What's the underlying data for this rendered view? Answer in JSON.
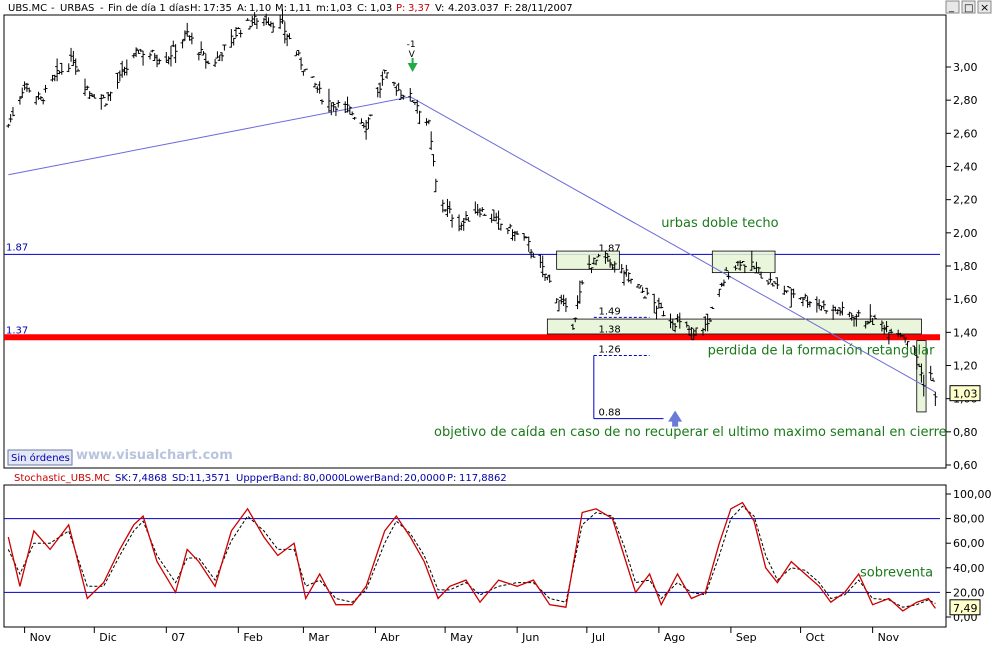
{
  "header": {
    "symbol": "UBS.MC",
    "name": "URBAS",
    "period": "Fin de día 1 días",
    "h_label": "H:",
    "h_value": "17:35",
    "a_label": "A:",
    "a_value": "1,10",
    "m_label": "M:",
    "m_value": "1,11",
    "lo_label": "m:",
    "lo_value": "1,03",
    "c_label": "C:",
    "c_value": "1,03",
    "p_label": "P:",
    "p_value": "3,37",
    "v_label": "V:",
    "v_value": "4.203.037",
    "f_label": "F:",
    "f_value": "28/11/2007"
  },
  "window_controls": {
    "minimize": "_",
    "maximize": "□",
    "close": "×"
  },
  "orders_button": "Sin órdenes",
  "watermark": "www.visualchart.com",
  "colors": {
    "price": "#000000",
    "trendline": "#6a6adc",
    "support": "#ff0000",
    "level": "#0000cc",
    "annotation": "#1a7a1a",
    "box_fill": "#e6f4d6",
    "stoch_k": "#cc0000",
    "stoch_d": "#000000",
    "band": "#0000cc"
  },
  "chart_data": [
    {
      "type": "ohlc",
      "symbol": "UBS.MC",
      "y_ticks": [
        "3,00",
        "2,80",
        "2,60",
        "2,40",
        "2,20",
        "2,00",
        "1,80",
        "1,60",
        "1,40",
        "1,20",
        "1,00",
        "0,80",
        "0,60"
      ],
      "ylim": [
        0.6,
        3.2
      ],
      "months": [
        "Nov",
        "Dic",
        "07",
        "Feb",
        "Mar",
        "Abr",
        "May",
        "Jun",
        "Jul",
        "Ago",
        "Sep",
        "Oct",
        "Nov"
      ],
      "close_path": [
        {
          "d": "2006-10-25",
          "c": 2.65
        },
        {
          "d": "2006-11-01",
          "c": 2.9
        },
        {
          "d": "2006-11-08",
          "c": 2.8
        },
        {
          "d": "2006-11-15",
          "c": 2.95
        },
        {
          "d": "2006-11-22",
          "c": 3.05
        },
        {
          "d": "2006-11-29",
          "c": 2.85
        },
        {
          "d": "2006-12-06",
          "c": 2.8
        },
        {
          "d": "2006-12-13",
          "c": 2.95
        },
        {
          "d": "2006-12-20",
          "c": 3.1
        },
        {
          "d": "2007-01-01",
          "c": 3.05
        },
        {
          "d": "2007-01-10",
          "c": 3.2
        },
        {
          "d": "2007-01-20",
          "c": 3.0
        },
        {
          "d": "2007-02-01",
          "c": 3.22
        },
        {
          "d": "2007-02-10",
          "c": 3.3
        },
        {
          "d": "2007-02-20",
          "c": 3.25
        },
        {
          "d": "2007-03-01",
          "c": 3.0
        },
        {
          "d": "2007-03-10",
          "c": 2.8
        },
        {
          "d": "2007-03-20",
          "c": 2.75
        },
        {
          "d": "2007-03-28",
          "c": 2.65
        },
        {
          "d": "2007-04-05",
          "c": 2.95
        },
        {
          "d": "2007-04-12",
          "c": 2.85
        },
        {
          "d": "2007-04-18",
          "c": 2.8
        },
        {
          "d": "2007-04-24",
          "c": 2.65
        },
        {
          "d": "2007-04-27",
          "c": 2.3
        },
        {
          "d": "2007-05-01",
          "c": 2.15
        },
        {
          "d": "2007-05-08",
          "c": 2.05
        },
        {
          "d": "2007-05-15",
          "c": 2.15
        },
        {
          "d": "2007-05-25",
          "c": 2.05
        },
        {
          "d": "2007-06-05",
          "c": 1.95
        },
        {
          "d": "2007-06-15",
          "c": 1.7
        },
        {
          "d": "2007-06-25",
          "c": 1.45
        },
        {
          "d": "2007-07-01",
          "c": 1.8
        },
        {
          "d": "2007-07-08",
          "c": 1.85
        },
        {
          "d": "2007-07-18",
          "c": 1.75
        },
        {
          "d": "2007-07-28",
          "c": 1.6
        },
        {
          "d": "2007-08-06",
          "c": 1.48
        },
        {
          "d": "2007-08-16",
          "c": 1.4
        },
        {
          "d": "2007-08-22",
          "c": 1.45
        },
        {
          "d": "2007-08-30",
          "c": 1.75
        },
        {
          "d": "2007-09-05",
          "c": 1.83
        },
        {
          "d": "2007-09-12",
          "c": 1.78
        },
        {
          "d": "2007-09-20",
          "c": 1.68
        },
        {
          "d": "2007-10-01",
          "c": 1.62
        },
        {
          "d": "2007-10-12",
          "c": 1.55
        },
        {
          "d": "2007-10-25",
          "c": 1.5
        },
        {
          "d": "2007-11-05",
          "c": 1.45
        },
        {
          "d": "2007-11-15",
          "c": 1.38
        },
        {
          "d": "2007-11-20",
          "c": 1.25
        },
        {
          "d": "2007-11-23",
          "c": 1.1
        },
        {
          "d": "2007-11-26",
          "c": 1.15
        },
        {
          "d": "2007-11-28",
          "c": 1.03
        }
      ],
      "last_price": "1,03",
      "trendlines": [
        {
          "from": {
            "d": "2006-10-25",
            "v": 2.35
          },
          "to": {
            "d": "2007-04-16",
            "v": 2.82
          }
        },
        {
          "from": {
            "d": "2007-04-16",
            "v": 2.82
          },
          "to": {
            "d": "2007-11-28",
            "v": 1.04
          }
        }
      ],
      "horizontal_levels": [
        {
          "value": 1.87,
          "label": "1.87"
        },
        {
          "value": 1.37,
          "label": "1.37",
          "style": "support"
        }
      ],
      "box_labels": [
        "1.87",
        "1.49",
        "1.38",
        "1.26",
        "0.88"
      ],
      "arrow_marker": {
        "top": "-1",
        "bottom": "V"
      },
      "annotations": [
        "urbas doble techo",
        "perdida de la formación retangular",
        "objetivo de caída en caso de no recuperar el ultimo maximo semanal en cierre"
      ]
    },
    {
      "type": "line",
      "title": "Stochastic_UBS.MC",
      "legend": {
        "sk_label": "SK:",
        "sk": "7,4868",
        "sd_label": "SD:",
        "sd": "11,3571",
        "upper_label": "UppperBand:",
        "upper": "80,0000",
        "lower_label": "LowerBand:",
        "lower": "20,0000",
        "p_label": "P:",
        "p": "117,8862"
      },
      "y_ticks": [
        "100,00",
        "80,00",
        "60,00",
        "40,00",
        "20,00",
        "0,00"
      ],
      "ylim": [
        0,
        100
      ],
      "bands": [
        80,
        20
      ],
      "last_value": "7,49",
      "annotation": "sobreventa",
      "series": [
        {
          "values_by_date": [
            {
              "d": "2006-10-25",
              "v": 65
            },
            {
              "d": "2006-10-30",
              "v": 25
            },
            {
              "d": "2006-11-05",
              "v": 70
            },
            {
              "d": "2006-11-12",
              "v": 55
            },
            {
              "d": "2006-11-20",
              "v": 75
            },
            {
              "d": "2006-11-28",
              "v": 15
            },
            {
              "d": "2006-12-05",
              "v": 28
            },
            {
              "d": "2006-12-12",
              "v": 55
            },
            {
              "d": "2006-12-18",
              "v": 75
            },
            {
              "d": "2006-12-22",
              "v": 82
            },
            {
              "d": "2006-12-28",
              "v": 45
            },
            {
              "d": "2007-01-05",
              "v": 20
            },
            {
              "d": "2007-01-10",
              "v": 55
            },
            {
              "d": "2007-01-15",
              "v": 45
            },
            {
              "d": "2007-01-22",
              "v": 25
            },
            {
              "d": "2007-01-29",
              "v": 70
            },
            {
              "d": "2007-02-05",
              "v": 88
            },
            {
              "d": "2007-02-12",
              "v": 65
            },
            {
              "d": "2007-02-18",
              "v": 50
            },
            {
              "d": "2007-02-25",
              "v": 60
            },
            {
              "d": "2007-03-02",
              "v": 15
            },
            {
              "d": "2007-03-08",
              "v": 35
            },
            {
              "d": "2007-03-15",
              "v": 10
            },
            {
              "d": "2007-03-22",
              "v": 10
            },
            {
              "d": "2007-03-28",
              "v": 25
            },
            {
              "d": "2007-04-05",
              "v": 70
            },
            {
              "d": "2007-04-10",
              "v": 82
            },
            {
              "d": "2007-04-16",
              "v": 65
            },
            {
              "d": "2007-04-22",
              "v": 45
            },
            {
              "d": "2007-04-28",
              "v": 15
            },
            {
              "d": "2007-05-03",
              "v": 25
            },
            {
              "d": "2007-05-10",
              "v": 30
            },
            {
              "d": "2007-05-16",
              "v": 12
            },
            {
              "d": "2007-05-24",
              "v": 30
            },
            {
              "d": "2007-06-01",
              "v": 25
            },
            {
              "d": "2007-06-08",
              "v": 30
            },
            {
              "d": "2007-06-15",
              "v": 10
            },
            {
              "d": "2007-06-22",
              "v": 8
            },
            {
              "d": "2007-06-29",
              "v": 85
            },
            {
              "d": "2007-07-05",
              "v": 88
            },
            {
              "d": "2007-07-12",
              "v": 80
            },
            {
              "d": "2007-07-17",
              "v": 50
            },
            {
              "d": "2007-07-22",
              "v": 20
            },
            {
              "d": "2007-07-28",
              "v": 35
            },
            {
              "d": "2007-08-02",
              "v": 10
            },
            {
              "d": "2007-08-09",
              "v": 35
            },
            {
              "d": "2007-08-15",
              "v": 15
            },
            {
              "d": "2007-08-21",
              "v": 20
            },
            {
              "d": "2007-08-27",
              "v": 60
            },
            {
              "d": "2007-09-01",
              "v": 88
            },
            {
              "d": "2007-09-06",
              "v": 93
            },
            {
              "d": "2007-09-11",
              "v": 78
            },
            {
              "d": "2007-09-16",
              "v": 40
            },
            {
              "d": "2007-09-21",
              "v": 28
            },
            {
              "d": "2007-09-27",
              "v": 45
            },
            {
              "d": "2007-10-03",
              "v": 35
            },
            {
              "d": "2007-10-09",
              "v": 25
            },
            {
              "d": "2007-10-14",
              "v": 12
            },
            {
              "d": "2007-10-20",
              "v": 20
            },
            {
              "d": "2007-10-26",
              "v": 35
            },
            {
              "d": "2007-11-01",
              "v": 10
            },
            {
              "d": "2007-11-08",
              "v": 15
            },
            {
              "d": "2007-11-14",
              "v": 5
            },
            {
              "d": "2007-11-20",
              "v": 12
            },
            {
              "d": "2007-11-25",
              "v": 15
            },
            {
              "d": "2007-11-28",
              "v": 7
            }
          ]
        },
        {
          "values_by_date": [
            {
              "d": "2006-10-25",
              "v": 55
            },
            {
              "d": "2006-10-30",
              "v": 35
            },
            {
              "d": "2006-11-05",
              "v": 60
            },
            {
              "d": "2006-11-12",
              "v": 60
            },
            {
              "d": "2006-11-20",
              "v": 70
            },
            {
              "d": "2006-11-28",
              "v": 25
            },
            {
              "d": "2006-12-05",
              "v": 25
            },
            {
              "d": "2006-12-12",
              "v": 50
            },
            {
              "d": "2006-12-18",
              "v": 70
            },
            {
              "d": "2006-12-22",
              "v": 78
            },
            {
              "d": "2006-12-28",
              "v": 50
            },
            {
              "d": "2007-01-05",
              "v": 28
            },
            {
              "d": "2007-01-10",
              "v": 48
            },
            {
              "d": "2007-01-15",
              "v": 48
            },
            {
              "d": "2007-01-22",
              "v": 30
            },
            {
              "d": "2007-01-29",
              "v": 62
            },
            {
              "d": "2007-02-05",
              "v": 82
            },
            {
              "d": "2007-02-12",
              "v": 70
            },
            {
              "d": "2007-02-18",
              "v": 55
            },
            {
              "d": "2007-02-25",
              "v": 55
            },
            {
              "d": "2007-03-02",
              "v": 25
            },
            {
              "d": "2007-03-08",
              "v": 30
            },
            {
              "d": "2007-03-15",
              "v": 15
            },
            {
              "d": "2007-03-22",
              "v": 12
            },
            {
              "d": "2007-03-28",
              "v": 22
            },
            {
              "d": "2007-04-05",
              "v": 60
            },
            {
              "d": "2007-04-10",
              "v": 78
            },
            {
              "d": "2007-04-16",
              "v": 68
            },
            {
              "d": "2007-04-22",
              "v": 50
            },
            {
              "d": "2007-04-28",
              "v": 22
            },
            {
              "d": "2007-05-03",
              "v": 22
            },
            {
              "d": "2007-05-10",
              "v": 28
            },
            {
              "d": "2007-05-16",
              "v": 18
            },
            {
              "d": "2007-05-24",
              "v": 25
            },
            {
              "d": "2007-06-01",
              "v": 28
            },
            {
              "d": "2007-06-08",
              "v": 28
            },
            {
              "d": "2007-06-15",
              "v": 15
            },
            {
              "d": "2007-06-22",
              "v": 12
            },
            {
              "d": "2007-06-29",
              "v": 75
            },
            {
              "d": "2007-07-05",
              "v": 85
            },
            {
              "d": "2007-07-12",
              "v": 82
            },
            {
              "d": "2007-07-17",
              "v": 58
            },
            {
              "d": "2007-07-22",
              "v": 28
            },
            {
              "d": "2007-07-28",
              "v": 30
            },
            {
              "d": "2007-08-02",
              "v": 15
            },
            {
              "d": "2007-08-09",
              "v": 28
            },
            {
              "d": "2007-08-15",
              "v": 20
            },
            {
              "d": "2007-08-21",
              "v": 18
            },
            {
              "d": "2007-08-27",
              "v": 50
            },
            {
              "d": "2007-09-01",
              "v": 80
            },
            {
              "d": "2007-09-06",
              "v": 90
            },
            {
              "d": "2007-09-11",
              "v": 82
            },
            {
              "d": "2007-09-16",
              "v": 50
            },
            {
              "d": "2007-09-21",
              "v": 30
            },
            {
              "d": "2007-09-27",
              "v": 40
            },
            {
              "d": "2007-10-03",
              "v": 38
            },
            {
              "d": "2007-10-09",
              "v": 28
            },
            {
              "d": "2007-10-14",
              "v": 15
            },
            {
              "d": "2007-10-20",
              "v": 18
            },
            {
              "d": "2007-10-26",
              "v": 30
            },
            {
              "d": "2007-11-01",
              "v": 15
            },
            {
              "d": "2007-11-08",
              "v": 14
            },
            {
              "d": "2007-11-14",
              "v": 8
            },
            {
              "d": "2007-11-20",
              "v": 10
            },
            {
              "d": "2007-11-25",
              "v": 14
            },
            {
              "d": "2007-11-28",
              "v": 11
            }
          ]
        }
      ]
    }
  ]
}
